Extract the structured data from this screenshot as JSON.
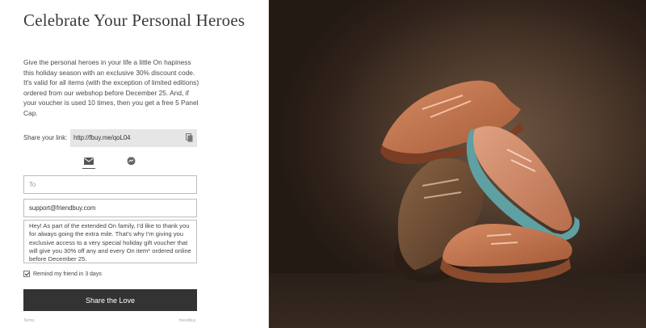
{
  "heading": "Celebrate Your Personal Heroes",
  "description": "Give the personal heroes in your life a little On hapiness this holiday season with an exclusive 30% discount code. It's valid for all items (with the exception of limited editions) ordered from our webshop before December 25. And, if your voucher is used 10 times, then you get a free 5 Panel Cap.",
  "share": {
    "label": "Share your link:",
    "link": "http://fbuy.me/qoL04",
    "copy_icon": "copy-icon"
  },
  "tabs": [
    {
      "name": "email",
      "icon": "mail-icon",
      "active": true
    },
    {
      "name": "messenger",
      "icon": "messenger-icon",
      "active": false
    }
  ],
  "form": {
    "to_placeholder": "To",
    "from_value": "support@friendbuy.com",
    "message": "Hey! As part of the extended On family, I'd like to thank you for always going the extra mile. That's why I'm giving you exclusive access to a very special holiday gift voucher that will give you 30% off any and every On item* ordered online before December 25.",
    "remind_label": "Remind my friend in 3 days",
    "remind_checked": true,
    "submit_label": "Share the Love"
  },
  "footer": {
    "terms": "Terms",
    "brand": "friendbuy"
  },
  "colors": {
    "button_bg": "#333333",
    "link_box_bg": "#e6e6e6",
    "photo_bg": "#4e3a2c",
    "shoe_orange": "#c8764f",
    "shoe_brown": "#6b4b32",
    "shoe_teal": "#5fa0a3"
  }
}
